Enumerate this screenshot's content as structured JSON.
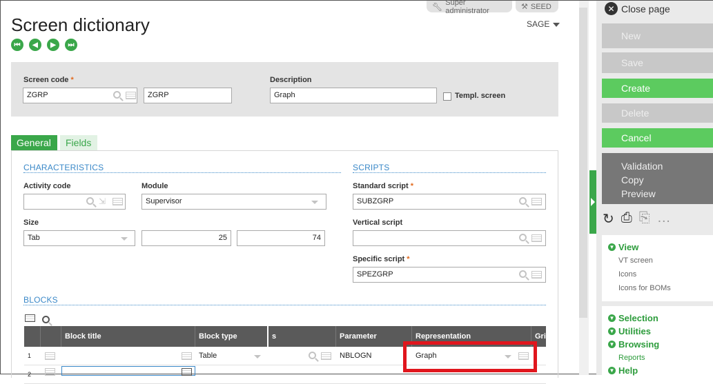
{
  "header": {
    "user_badge": "Super administrator",
    "folder_badge": "SEED",
    "title": "Screen dictionary",
    "folder": "SAGE",
    "nav": [
      "first",
      "prev",
      "next",
      "last"
    ]
  },
  "key_fields": {
    "screen_code_label": "Screen code",
    "screen_code_value": "ZGRP",
    "screen_code_copy": "ZGRP",
    "description_label": "Description",
    "description_value": "Graph",
    "templ_screen_label": "Templ. screen"
  },
  "tabs": [
    "General",
    "Fields"
  ],
  "characteristics": {
    "title": "CHARACTERISTICS",
    "activity_code_label": "Activity code",
    "activity_code_value": "",
    "module_label": "Module",
    "module_value": "Supervisor",
    "size_label": "Size",
    "size_value": "Tab",
    "size_w": "25",
    "size_h": "74"
  },
  "scripts": {
    "title": "SCRIPTS",
    "standard_label": "Standard script",
    "standard_value": "SUBZGRP",
    "vertical_label": "Vertical script",
    "vertical_value": "",
    "specific_label": "Specific script",
    "specific_value": "SPEZGRP"
  },
  "blocks": {
    "title": "BLOCKS",
    "columns": [
      "Block title",
      "Block type",
      "s",
      "Parameter",
      "Representation",
      "Gri"
    ],
    "rows": [
      {
        "num": "1",
        "title": "",
        "type": "Table",
        "param": "NBLOGN",
        "repr": "Graph"
      },
      {
        "num": "2",
        "title": "",
        "type": "",
        "param": "",
        "repr": ""
      }
    ]
  },
  "right_panel": {
    "close": "Close page",
    "new": "New",
    "save": "Save",
    "create": "Create",
    "delete": "Delete",
    "cancel": "Cancel",
    "validation": "Validation",
    "copy": "Copy",
    "preview": "Preview",
    "view_title": "View",
    "view_links": [
      "VT screen",
      "Icons",
      "Icons for BOMs"
    ],
    "selection": "Selection",
    "utilities": "Utilities",
    "browsing": "Browsing",
    "reports": "Reports",
    "help": "Help"
  },
  "colors": {
    "accent": "#3aa74a",
    "highlight": "#e0161d",
    "section": "#3a88c8"
  }
}
